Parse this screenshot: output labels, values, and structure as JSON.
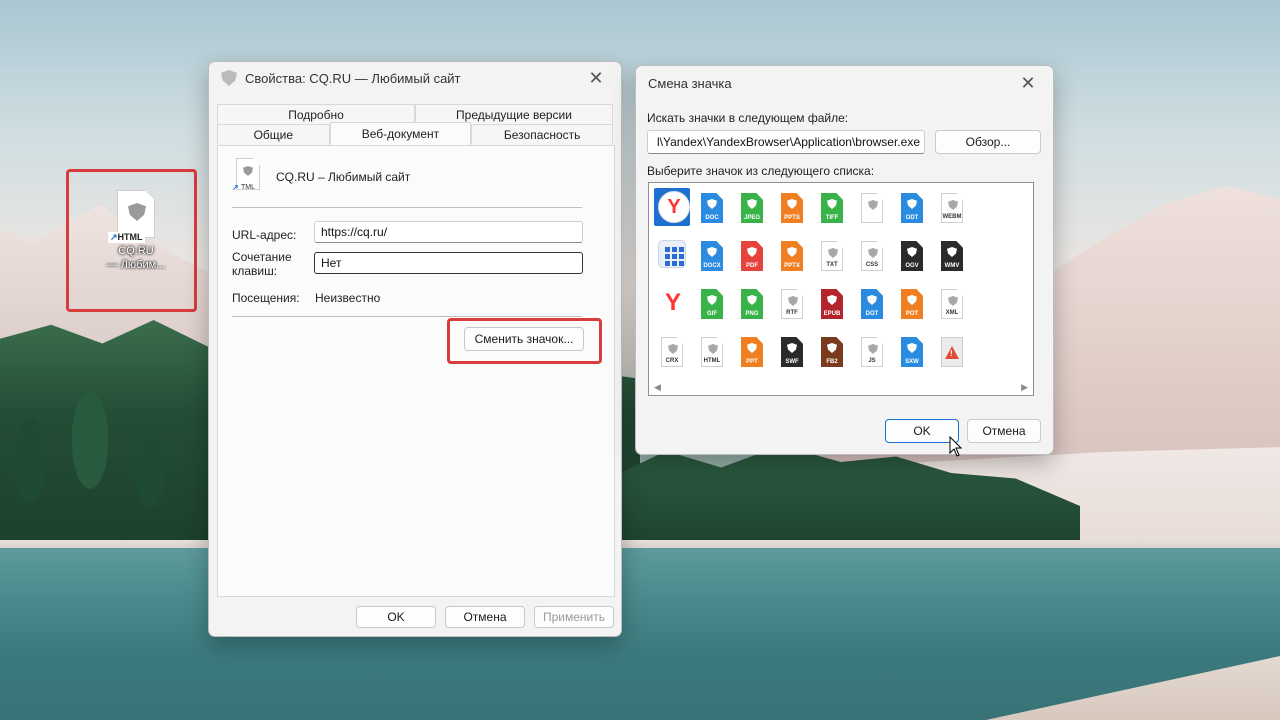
{
  "desktop": {
    "icon_tag": "HTML",
    "icon_caption_line1": "CQ.RU",
    "icon_caption_line2": "— Любим..."
  },
  "properties_dialog": {
    "title": "Свойства: CQ.RU — Любимый сайт",
    "tabs_row1": [
      "Подробно",
      "Предыдущие версии"
    ],
    "tabs_row2": [
      "Общие",
      "Веб-документ",
      "Безопасность"
    ],
    "active_tab": "Веб-документ",
    "file_name": "CQ.RU – Любимый сайт",
    "file_icon_tag": "TML",
    "url_label": "URL-адрес:",
    "url_value": "https://cq.ru/",
    "shortcut_label_line1": "Сочетание",
    "shortcut_label_line2": "клавиш:",
    "shortcut_value": "Нет",
    "visits_label": "Посещения:",
    "visits_value": "Неизвестно",
    "change_icon_button": "Сменить значок...",
    "ok_button": "OK",
    "cancel_button": "Отмена",
    "apply_button": "Применить"
  },
  "change_icon_dialog": {
    "title": "Смена значка",
    "search_file_label": "Искать значки в следующем файле:",
    "file_path": "l\\Yandex\\YandexBrowser\\Application\\browser.exe",
    "browse_button": "Обзор...",
    "select_label": "Выберите значок из следующего списка:",
    "icons": [
      {
        "kind": "yandex-round",
        "label": ""
      },
      {
        "kind": "file",
        "label": "DOC",
        "color": "#2b8be0"
      },
      {
        "kind": "file",
        "label": "JPEG",
        "color": "#3ab24a"
      },
      {
        "kind": "file",
        "label": "PPTS",
        "color": "#f07f22"
      },
      {
        "kind": "file",
        "label": "TIFF",
        "color": "#3ab24a"
      },
      {
        "kind": "file-white",
        "label": ""
      },
      {
        "kind": "file",
        "label": "ODT",
        "color": "#2b8be0"
      },
      {
        "kind": "file-white",
        "label": "WEBM"
      },
      {
        "kind": "apps",
        "label": ""
      },
      {
        "kind": "file",
        "label": "DOCX",
        "color": "#2b8be0"
      },
      {
        "kind": "file",
        "label": "PDF",
        "color": "#e5433b"
      },
      {
        "kind": "file",
        "label": "PPTX",
        "color": "#f07f22"
      },
      {
        "kind": "file-white",
        "label": "TXT"
      },
      {
        "kind": "file-white",
        "label": "CSS"
      },
      {
        "kind": "file",
        "label": "OGV",
        "color": "#2a2a2a"
      },
      {
        "kind": "file",
        "label": "WMV",
        "color": "#2a2a2a"
      },
      {
        "kind": "yandex-plain",
        "label": ""
      },
      {
        "kind": "file",
        "label": "GIF",
        "color": "#3ab24a"
      },
      {
        "kind": "file",
        "label": "PNG",
        "color": "#3ab24a"
      },
      {
        "kind": "file-white",
        "label": "RTF"
      },
      {
        "kind": "file",
        "label": "EPUB",
        "color": "#b3242c"
      },
      {
        "kind": "file",
        "label": "DOT",
        "color": "#2b8be0"
      },
      {
        "kind": "file",
        "label": "POT",
        "color": "#f07f22"
      },
      {
        "kind": "file-white",
        "label": "XML"
      },
      {
        "kind": "file-white",
        "label": "CRX"
      },
      {
        "kind": "file-white",
        "label": "HTML"
      },
      {
        "kind": "file",
        "label": "PPT",
        "color": "#f07f22"
      },
      {
        "kind": "file",
        "label": "SWF",
        "color": "#2a2a2a"
      },
      {
        "kind": "file",
        "label": "FB2",
        "color": "#7a3a1e"
      },
      {
        "kind": "file-white",
        "label": "JS"
      },
      {
        "kind": "file",
        "label": "SXW",
        "color": "#2b8be0"
      },
      {
        "kind": "warning",
        "label": ""
      }
    ],
    "ok_button": "OK",
    "cancel_button": "Отмена"
  },
  "colors": {
    "highlight_red": "#d93c3c",
    "accent_blue": "#1e6fd2"
  }
}
